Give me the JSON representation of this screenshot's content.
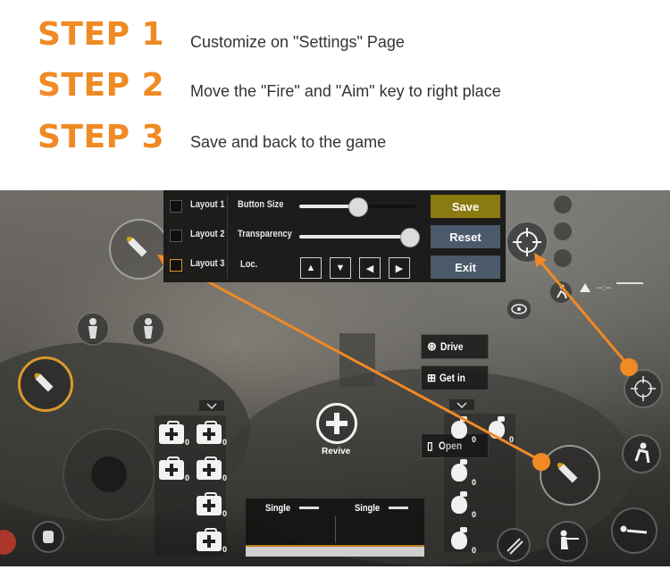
{
  "steps": [
    {
      "title": "STEP 1",
      "desc": "Customize on \"Settings\" Page"
    },
    {
      "title": "STEP 2",
      "desc": "Move the \"Fire\" and \"Aim\" key to right place"
    },
    {
      "title": "STEP 3",
      "desc": "Save and back to the game"
    }
  ],
  "panel": {
    "layouts": [
      "Layout 1",
      "Layout 2",
      "Layout 3"
    ],
    "button_size_label": "Button Size",
    "transparency_label": "Transparency",
    "loc_label": "Loc.",
    "button_size_value": 0.5,
    "transparency_value": 0.95,
    "save": "Save",
    "reset": "Reset",
    "exit": "Exit"
  },
  "hud": {
    "drive": "Drive",
    "get_in": "Get in",
    "open": "Open",
    "revive": "Revive",
    "fire_mode_left": "Single",
    "fire_mode_right": "Single",
    "status": "--:--",
    "medkit_count": "0",
    "grenade_count": "0"
  },
  "colors": {
    "step_orange": "#f08a24",
    "save_button": "#8a7a10",
    "reset_button": "#4a5a6a",
    "exit_button": "#4a5a6a"
  }
}
